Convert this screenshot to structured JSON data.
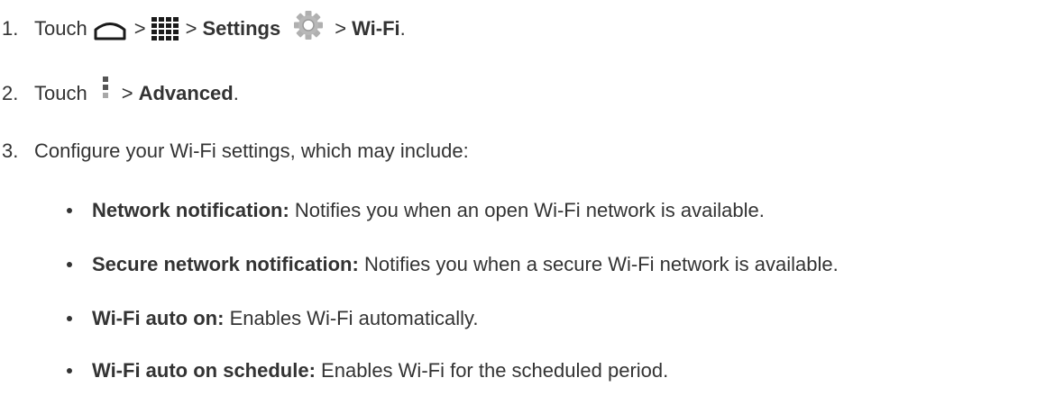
{
  "steps": [
    {
      "number": "1.",
      "touch": "Touch",
      "sep": ">",
      "settings": "Settings",
      "wifi": "Wi-Fi",
      "end": "."
    },
    {
      "number": "2.",
      "touch": "Touch",
      "sep": ">",
      "advanced": "Advanced",
      "end": "."
    },
    {
      "number": "3.",
      "text": "Configure your Wi-Fi settings, which may include:"
    }
  ],
  "options": [
    {
      "label": "Network notification:",
      "desc": "Notifies you when an open Wi-Fi network is available."
    },
    {
      "label": "Secure network notification:",
      "desc": "Notifies you when a secure Wi-Fi network is available."
    },
    {
      "label": "Wi-Fi auto on:",
      "desc": "Enables Wi-Fi automatically."
    },
    {
      "label": "Wi-Fi auto on schedule:",
      "desc": "Enables Wi-Fi for the scheduled period."
    }
  ],
  "icons": {
    "home": "home-icon",
    "apps": "apps-grid-icon",
    "settings": "settings-gear-icon",
    "menu": "overflow-menu-icon"
  }
}
